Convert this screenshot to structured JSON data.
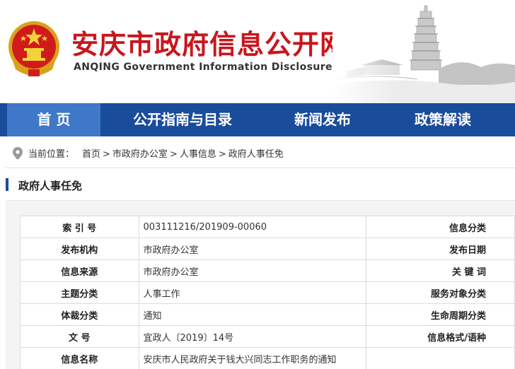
{
  "header": {
    "title": "安庆市政府信息公开网",
    "subtitle": "ANQING Government Information Disclosure Network"
  },
  "nav": {
    "items": [
      {
        "label": "首 页",
        "active": true
      },
      {
        "label": "公开指南与目录",
        "active": false
      },
      {
        "label": "新闻发布",
        "active": false
      },
      {
        "label": "政策解读",
        "active": false
      }
    ]
  },
  "breadcrumb": {
    "label": "当前位置：",
    "items": [
      "首页",
      "市政府办公室",
      "人事信息",
      "政府人事任免"
    ],
    "separators": [
      ">",
      ">",
      ">"
    ]
  },
  "panel": {
    "title": "政府人事任免"
  },
  "info": {
    "rows": [
      {
        "label": "索 引 号",
        "value": "003111216/201909-00060",
        "label2": "信息分类"
      },
      {
        "label": "发布机构",
        "value": "市政府办公室",
        "label2": "发布日期"
      },
      {
        "label": "信息来源",
        "value": "市政府办公室",
        "label2": "关 键 词"
      },
      {
        "label": "主题分类",
        "value": "人事工作",
        "label2": "服务对象分类"
      },
      {
        "label": "体裁分类",
        "value": "通知",
        "label2": "生命周期分类"
      },
      {
        "label": "文 号",
        "value": "宜政人〔2019〕14号",
        "label2": "信息格式/语种"
      },
      {
        "label": "信息名称",
        "value": "安庆市人民政府关于钱大兴同志工作职务的通知",
        "label2": ""
      }
    ]
  },
  "colors": {
    "title_red": "#c8161d",
    "nav_blue": "#1a4c9c",
    "nav_active": "#3f78c8"
  }
}
